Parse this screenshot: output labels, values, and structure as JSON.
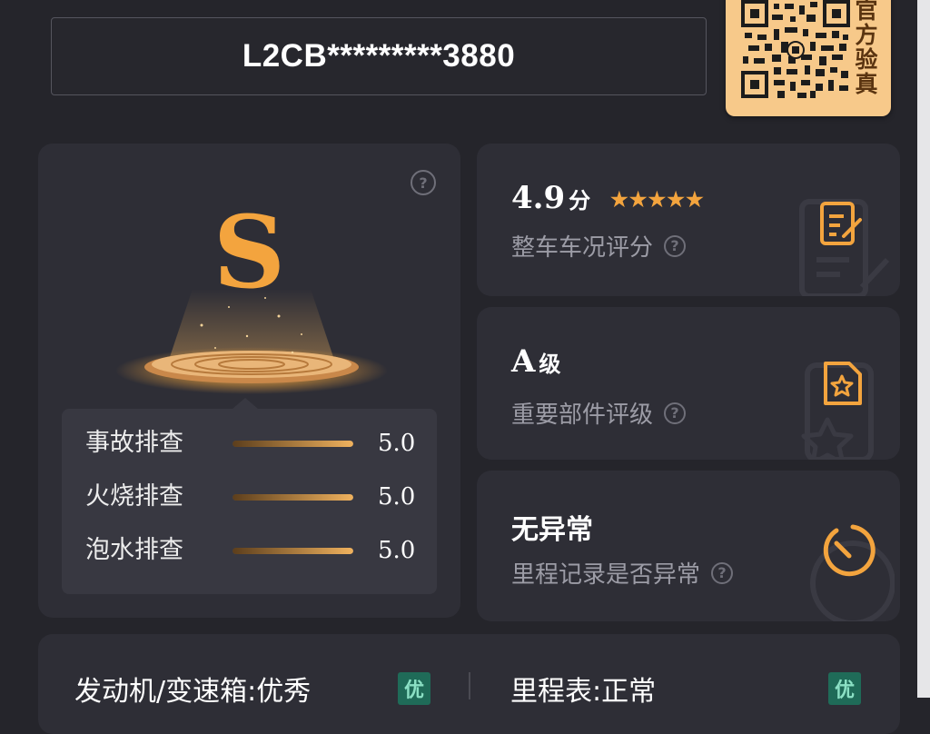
{
  "vin": {
    "text": "L2CB*********3880"
  },
  "qr_badge": {
    "chars": [
      "官",
      "方",
      "验",
      "真"
    ]
  },
  "grade_card": {
    "grade": "S",
    "help_icon": "question-circle-icon",
    "scores": [
      {
        "label": "事故排查",
        "value": "5.0",
        "fill": 1.0
      },
      {
        "label": "火烧排查",
        "value": "5.0",
        "fill": 1.0
      },
      {
        "label": "泡水排查",
        "value": "5.0",
        "fill": 1.0
      }
    ]
  },
  "rating_card": {
    "score": "4.9",
    "unit": "分",
    "stars": 5,
    "subtitle": "整车车况评分",
    "icon": "document-edit-icon"
  },
  "parts_card": {
    "grade": "A",
    "unit": "级",
    "subtitle": "重要部件评级",
    "icon": "document-star-icon"
  },
  "mileage_card": {
    "title": "无异常",
    "subtitle": "里程记录是否异常",
    "icon": "gauge-timer-icon"
  },
  "bottom": {
    "left_text": "发动机/变速箱:优秀",
    "left_badge": "优",
    "right_text": "里程表:正常",
    "right_badge": "优"
  },
  "colors": {
    "accent": "#f3a43e",
    "background": "#25252b",
    "card": "#2e2e36",
    "badge_bg": "#1f6b58"
  }
}
